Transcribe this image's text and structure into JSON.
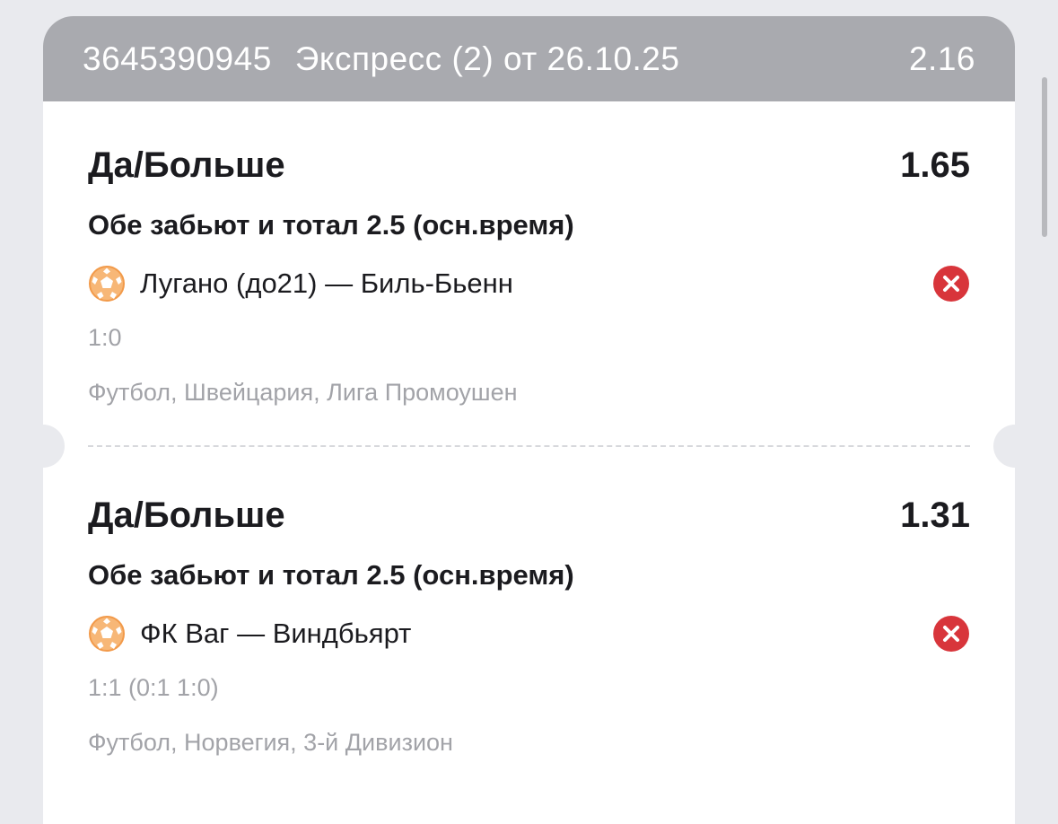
{
  "header": {
    "bet_id": "3645390945",
    "title": "Экспресс (2) от 26.10.25",
    "total_odds": "2.16"
  },
  "bets": [
    {
      "market": "Да/Больше",
      "odds": "1.65",
      "bet_type": "Обе забьют и тотал 2.5 (осн.время)",
      "sport_icon": "soccer-ball-icon",
      "match": "Лугано (до21) — Биль-Бьенн",
      "status_icon": "lost-x-icon",
      "score": "1:0",
      "league": "Футбол, Швейцария, Лига Промоушен"
    },
    {
      "market": "Да/Больше",
      "odds": "1.31",
      "bet_type": "Обе забьют и тотал 2.5 (осн.время)",
      "sport_icon": "soccer-ball-icon",
      "match": "ФК Ваг — Виндбьярт",
      "status_icon": "lost-x-icon",
      "score": "1:1 (0:1 1:0)",
      "league": "Футбол, Норвегия, 3-й Дивизион"
    }
  ],
  "colors": {
    "header_bg": "#a9aaaf",
    "page_bg": "#e9eaee",
    "card_bg": "#ffffff",
    "ball_orange": "#f29a4a",
    "lost_red": "#d8353b",
    "muted_text": "#a2a3a8"
  }
}
